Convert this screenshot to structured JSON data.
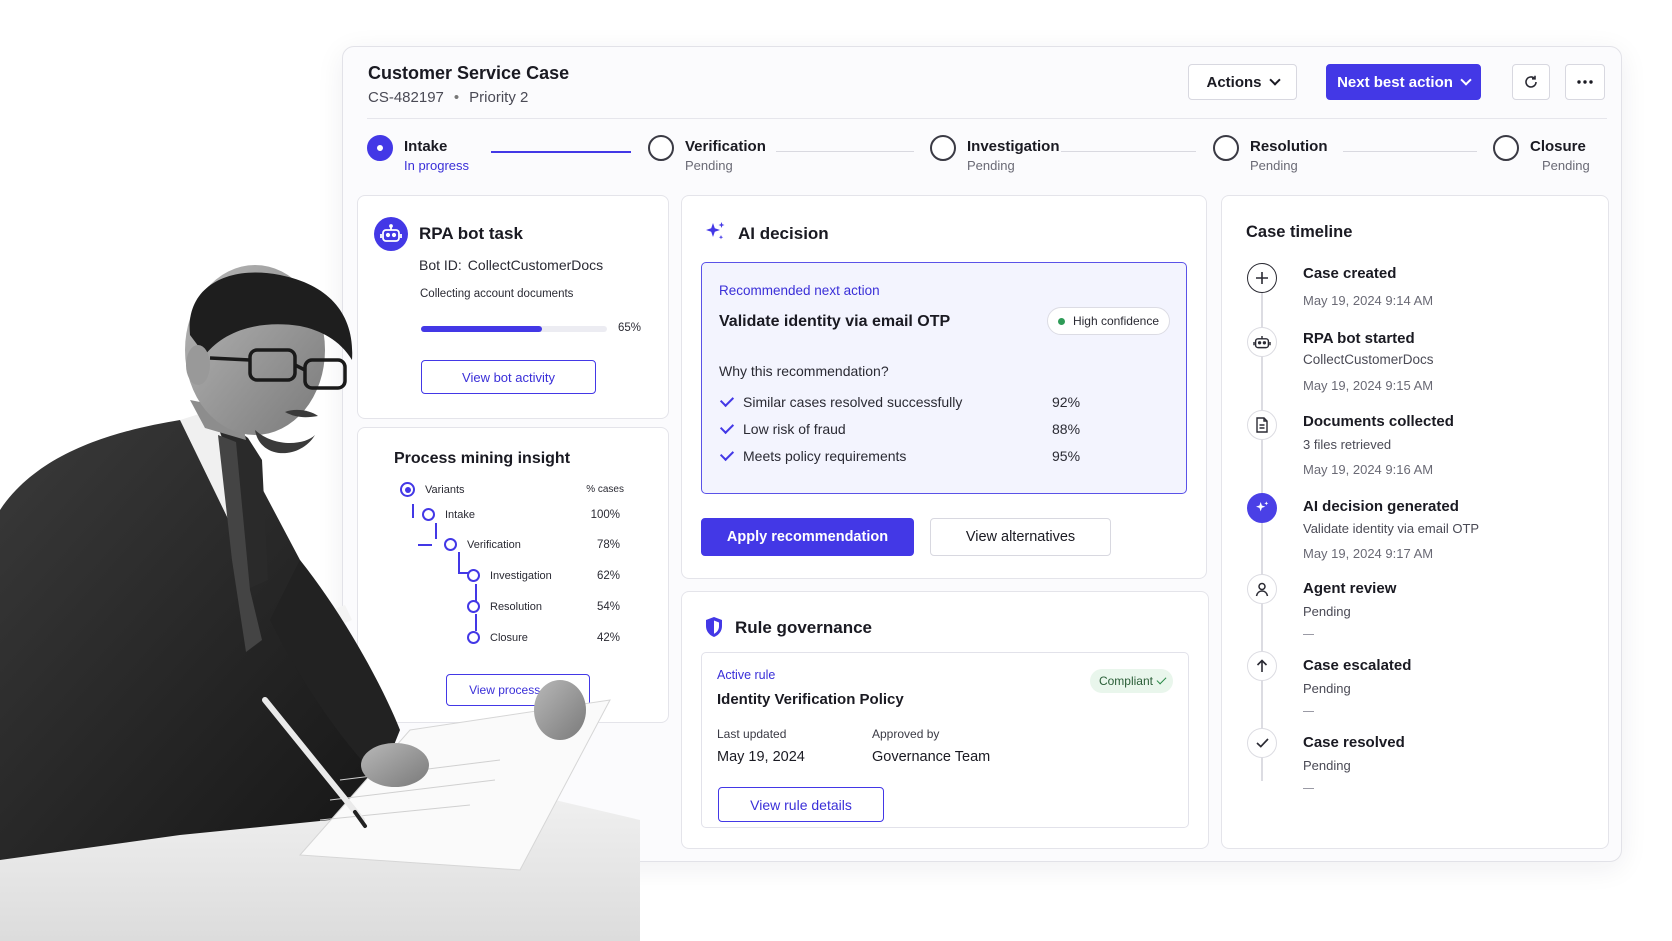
{
  "case": {
    "title": "Customer Service Case",
    "id": "CS-482197",
    "separator": "•",
    "priority": "Priority 2"
  },
  "toolbar": {
    "actions_label": "Actions",
    "next_best_action_label": "Next best action",
    "refresh_icon": "refresh-icon",
    "more_icon": "more-horizontal-icon"
  },
  "steps": [
    {
      "label": "Intake",
      "status": "In progress"
    },
    {
      "label": "Verification",
      "status": "Pending"
    },
    {
      "label": "Investigation",
      "status": "Pending"
    },
    {
      "label": "Resolution",
      "status": "Pending"
    },
    {
      "label": "Closure",
      "status": "Pending"
    }
  ],
  "rpa": {
    "title": "RPA bot task",
    "bot_id_label": "Bot ID:",
    "bot_id": "CollectCustomerDocs",
    "description": "Collecting account documents",
    "progress": 65,
    "progress_label": "65%",
    "button": "View bot activity"
  },
  "process_mining": {
    "title": "Process mining insight",
    "variants_label": "Variants",
    "cases_label": "% cases",
    "rows": [
      {
        "label": "Intake",
        "pct": "100%"
      },
      {
        "label": "Verification",
        "pct": "78%"
      },
      {
        "label": "Investigation",
        "pct": "62%"
      },
      {
        "label": "Resolution",
        "pct": "54%"
      },
      {
        "label": "Closure",
        "pct": "42%"
      }
    ],
    "button": "View process map"
  },
  "ai_decision": {
    "title": "AI decision",
    "recommended_label": "Recommended next action",
    "recommendation": "Validate identity via email OTP",
    "confidence": "High confidence",
    "why_label": "Why this recommendation?",
    "reasons": [
      {
        "text": "Similar cases resolved successfully",
        "pct": "92%"
      },
      {
        "text": "Low risk of fraud",
        "pct": "88%"
      },
      {
        "text": "Meets policy requirements",
        "pct": "95%"
      }
    ],
    "apply_button": "Apply recommendation",
    "alternatives_button": "View alternatives"
  },
  "rule_governance": {
    "title": "Rule governance",
    "active_rule_label": "Active rule",
    "rule_name": "Identity Verification Policy",
    "status": "Compliant",
    "last_updated_label": "Last updated",
    "last_updated": "May 19, 2024",
    "approved_by_label": "Approved by",
    "approved_by": "Governance Team",
    "button": "View rule details"
  },
  "timeline": {
    "title": "Case timeline",
    "events": [
      {
        "title": "Case created",
        "sub": "",
        "time": "May 19, 2024 9:14 AM",
        "icon": "plus-circle-icon"
      },
      {
        "title": "RPA bot started",
        "sub": "CollectCustomerDocs",
        "time": "May 19, 2024 9:15 AM",
        "icon": "robot-icon"
      },
      {
        "title": "Documents collected",
        "sub": "3 files retrieved",
        "time": "May 19, 2024 9:16 AM",
        "icon": "document-icon"
      },
      {
        "title": "AI decision generated",
        "sub": "Validate identity via email OTP",
        "time": "May 19, 2024 9:17 AM",
        "icon": "sparkle-icon"
      },
      {
        "title": "Agent review",
        "sub": "Pending",
        "time": "—",
        "icon": "user-icon"
      },
      {
        "title": "Case escalated",
        "sub": "Pending",
        "time": "—",
        "icon": "arrow-up-icon"
      },
      {
        "title": "Case resolved",
        "sub": "Pending",
        "time": "—",
        "icon": "check-icon"
      }
    ]
  },
  "colors": {
    "accent": "#4338e6",
    "success": "#2e9b57"
  }
}
